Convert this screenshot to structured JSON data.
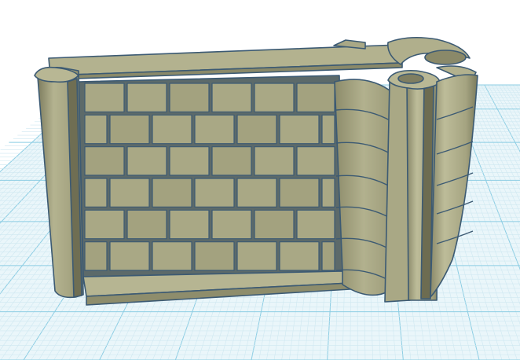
{
  "colors": {
    "background": "#ffffff",
    "grid_minor": "#cfe8f1",
    "grid_major": "#8ccde3",
    "model_face": "#a8a783",
    "model_light": "#b7b693",
    "model_shadow": "#878666",
    "model_dark": "#5f5f47",
    "model_outline": "#3c5a73"
  },
  "workplane": {
    "label": ""
  },
  "model": {
    "name": "wall-section-with-pillars"
  }
}
